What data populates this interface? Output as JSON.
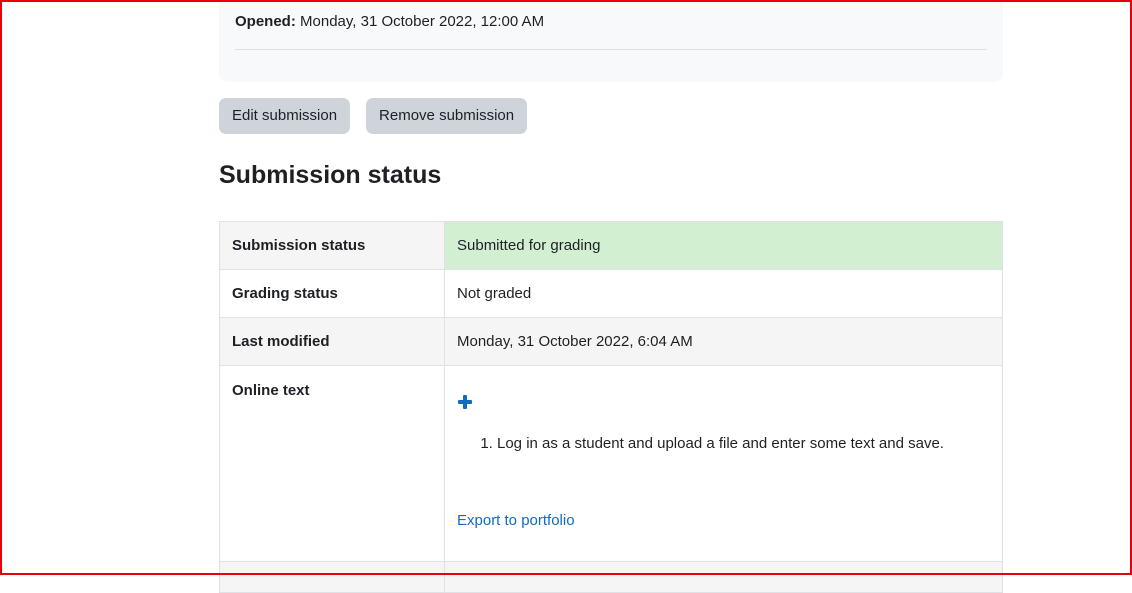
{
  "dates": {
    "opened_label": "Opened:",
    "opened_value": "Monday, 31 October 2022, 12:00 AM"
  },
  "actions": {
    "edit_label": "Edit submission",
    "remove_label": "Remove submission"
  },
  "section": {
    "title": "Submission status"
  },
  "status_table": {
    "rows": [
      {
        "label": "Submission status",
        "value": "Submitted for grading"
      },
      {
        "label": "Grading status",
        "value": "Not graded"
      },
      {
        "label": "Last modified",
        "value": "Monday, 31 October 2022, 6:04 AM"
      },
      {
        "label": "Online text"
      }
    ],
    "online_text": {
      "expand_icon": "plus-icon",
      "items": [
        "Log in as a student and upload a file and enter some text and save."
      ],
      "export_link": "Export to portfolio"
    }
  },
  "colors": {
    "success_bg": "#d2efd2",
    "link": "#0f6cbf",
    "button_bg": "#ced4da",
    "frame_border": "#e8000b"
  }
}
